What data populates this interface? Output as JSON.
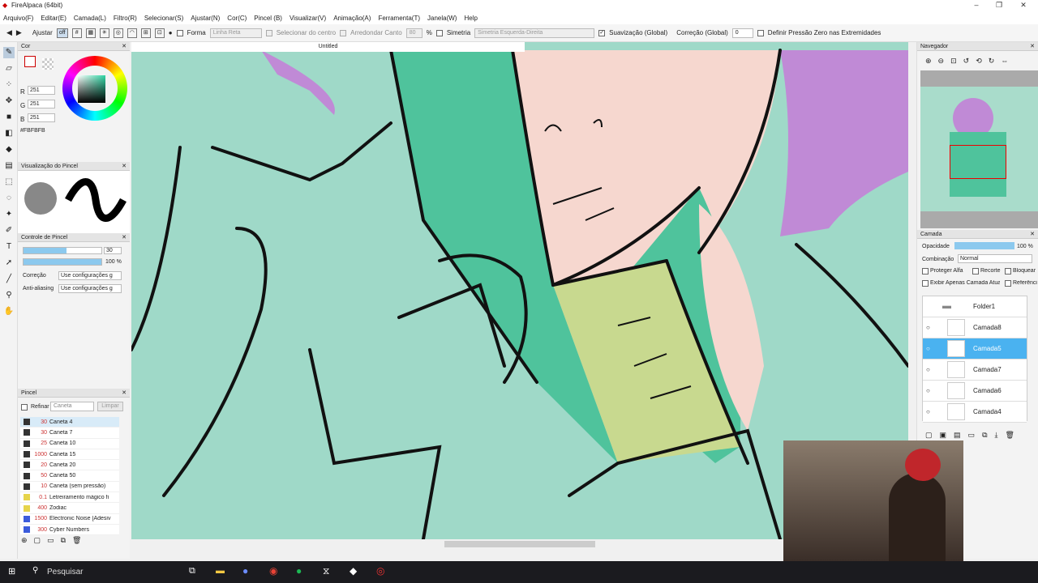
{
  "window": {
    "title": "FireAlpaca (64bit)"
  },
  "menu": [
    "Arquivo(F)",
    "Editar(E)",
    "Camada(L)",
    "Filtro(R)",
    "Selecionar(S)",
    "Ajustar(N)",
    "Cor(C)",
    "Pincel (B)",
    "Visualizar(V)",
    "Animação(A)",
    "Ferramenta(T)",
    "Janela(W)",
    "Help"
  ],
  "toolbar": {
    "ajustar": "Ajustar",
    "off": "off",
    "forma": "Forma",
    "linha_reta": "Linha Reta",
    "selecionar_centro": "Selecionar do centro",
    "arredondar_canto": "Arredondar Canto",
    "canto_val": "80",
    "pct": "%",
    "simetria": "Simetria",
    "simetria_sel": "Simetria Esquerda-Direita",
    "suavizacao": "Suavização (Global)",
    "correcao": "Correção (Global)",
    "correcao_val": "0",
    "pressao": "Definir Pressão Zero nas Extremidades"
  },
  "color_panel": {
    "title": "Cor",
    "r_label": "R",
    "r": "251",
    "g_label": "G",
    "g": "251",
    "b_label": "B",
    "b": "251",
    "hex": "#FBFBFB"
  },
  "brush_preview": {
    "title": "Visualização do Pincel"
  },
  "brush_control": {
    "title": "Controle de Pincel",
    "size": "30",
    "opacity": "100 %",
    "correcao": "Correção",
    "correcao_sel": "Use configurações g",
    "antialias": "Anti-aliasing",
    "antialias_sel": "Use configurações g"
  },
  "brush_panel": {
    "title": "Pincel",
    "refinar": "Refinar",
    "caneta": "Caneta",
    "limpar": "Limpar",
    "items": [
      {
        "size": "30",
        "name": "Caneta 4",
        "color": "#333"
      },
      {
        "size": "30",
        "name": "Caneta 7",
        "color": "#333"
      },
      {
        "size": "25",
        "name": "Caneta 10",
        "color": "#333"
      },
      {
        "size": "1000",
        "name": "Caneta 15",
        "color": "#333"
      },
      {
        "size": "20",
        "name": "Caneta 20",
        "color": "#333"
      },
      {
        "size": "50",
        "name": "Caneta 50",
        "color": "#333"
      },
      {
        "size": "10",
        "name": "Caneta (sem pressão)",
        "color": "#333"
      },
      {
        "size": "0.1",
        "name": "Letreiramento mágico fi",
        "color": "#e6d44a"
      },
      {
        "size": "400",
        "name": "Zodiac",
        "color": "#e6d44a"
      },
      {
        "size": "1500",
        "name": "Electronic Noise [Adesiv",
        "color": "#3b5bdb"
      },
      {
        "size": "300",
        "name": "Cyber Numbers",
        "color": "#3b5bdb"
      }
    ]
  },
  "doc": {
    "tab": "Untitled"
  },
  "navigator": {
    "title": "Navegador"
  },
  "layers": {
    "title": "Camada",
    "opacidade": "Opacidade",
    "opacity_val": "100 %",
    "combinacao": "Combinação",
    "combinacao_val": "Normal",
    "proteger": "Proteger Alfa",
    "recorte": "Recorte",
    "bloquear": "Bloquear",
    "exibir": "Exibir Apenas Camada Atual",
    "referencia": "Referência",
    "folder": "Folder1",
    "items": [
      "Camada8",
      "Camada5",
      "Camada7",
      "Camada6",
      "Camada4"
    ]
  },
  "taskbar": {
    "search": "Pesquisar"
  }
}
